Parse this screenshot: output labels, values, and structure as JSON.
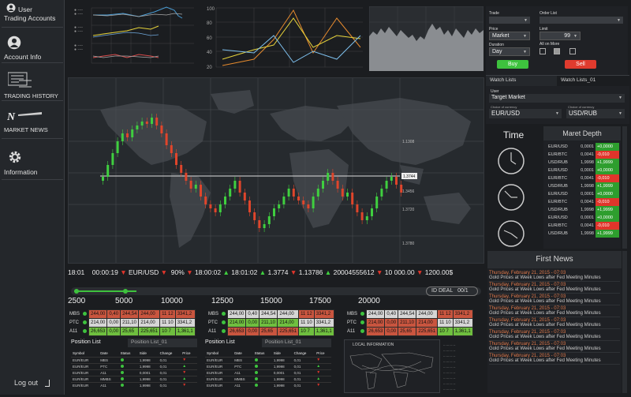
{
  "sidebar": {
    "items": [
      {
        "label_line1": "User",
        "label_line2": "Trading Accounts",
        "icon": "user-icon"
      },
      {
        "label": "Account Info",
        "icon": "user-icon"
      },
      {
        "label": "TRADING HISTORY",
        "icon": "history-icon"
      },
      {
        "label": "MARKET NEWS",
        "icon": "news-icon"
      },
      {
        "label": "Information",
        "icon": "gear-icon"
      }
    ],
    "logout": "Log out"
  },
  "map_chart": {
    "price_tags": [
      "1.1308",
      "1.3744",
      "1.3456",
      "1.3720",
      "1.3780"
    ]
  },
  "ticker": {
    "time": "18:01",
    "timer": "00:00:19",
    "pair": "EUR/USD",
    "pct": "90%",
    "t2": "18:00:02",
    "t3": "18:01:02",
    "v1": "1.3774",
    "v2": "1.13786",
    "v3": "20004555612",
    "v4": "10 000.00",
    "v5": "1200.00$"
  },
  "slider": {
    "id_deal_label": "ID DEAL",
    "id_deal_value": "00/1",
    "values": [
      "2500",
      "5000",
      "10000",
      "12500",
      "15000",
      "17500",
      "20000"
    ],
    "fill_fraction": 0.18
  },
  "quotes": {
    "rows": [
      {
        "name": "MBS",
        "cells": [
          "244,00",
          "0,40",
          "244,54",
          "244,00",
          "11 12",
          "3341,2"
        ]
      },
      {
        "name": "PTC",
        "cells": [
          "214,00",
          "0,00",
          "211,10",
          "214,00",
          "11 10",
          "3341,2"
        ]
      },
      {
        "name": "A11",
        "cells": [
          "26,653",
          "0,00",
          "25,65",
          "225,651",
          "10 7",
          "1,361,1"
        ]
      }
    ]
  },
  "position": [
    {
      "title": "Position List",
      "tab": "Position List_01"
    },
    {
      "title": "Position List",
      "tab": "Position List_01"
    }
  ],
  "position_table": {
    "headers": [
      "Symbol",
      "Date",
      "Status",
      "Side",
      "Change",
      "Price"
    ],
    "rows": [
      [
        "EUR/EUR",
        "MBS",
        "",
        "1,9998",
        "0,01",
        ""
      ],
      [
        "EUR/EUR",
        "PTC",
        "",
        "1,9998",
        "0,01",
        ""
      ],
      [
        "EUR/EUR",
        "A11",
        "",
        "0,0001",
        "0,01",
        ""
      ],
      [
        "EUR/EUR",
        "MMBS",
        "",
        "1,9998",
        "0,01",
        ""
      ],
      [
        "EUR/EUR",
        "A11",
        "",
        "1,9998",
        "0,01",
        ""
      ]
    ]
  },
  "local_info": {
    "title": "LOCAL INFORMATION"
  },
  "trade_panel": {
    "trade_label": "Trade",
    "order_list_label": "Order List",
    "price_label": "Price",
    "price_value": "Market",
    "limit_label": "Limit",
    "limit_value": "99",
    "duration_label": "Duration",
    "duration_value": "Day",
    "all_or_more_label": "All on More",
    "buy": "Buy",
    "sell": "Sell"
  },
  "watch": {
    "tab1": "Watch Lists",
    "tab2": "Watch Lists_01",
    "user_label": "User",
    "target": "Target Market",
    "choice1_label": "Choice of currency",
    "choice1": "EUR/USD",
    "choice2_label": "Choice of currency",
    "choice2": "USD/RUB"
  },
  "time_label": "Time",
  "depth": {
    "title": "Maret Depth",
    "rows": [
      [
        "EUR/USD",
        "0,0001",
        "+0,0000"
      ],
      [
        "EUR/BTC",
        "0,0041",
        "-0,010"
      ],
      [
        "USD/RUB",
        "1,9998",
        "+1,9999"
      ],
      [
        "EUR/USD",
        "0,0001",
        "+0,0000"
      ],
      [
        "EUR/BTC",
        "0,0041",
        "-0,010"
      ],
      [
        "USD/RUB",
        "1,9998",
        "+1,9999"
      ],
      [
        "EUR/USD",
        "0,0001",
        "+0,0000"
      ],
      [
        "EUR/BTC",
        "0,0041",
        "-0,010"
      ],
      [
        "USD/RUB",
        "1,9998",
        "+1,9999"
      ],
      [
        "EUR/USD",
        "0,0001",
        "+0,0000"
      ],
      [
        "EUR/BTC",
        "0,0041",
        "-0,010"
      ],
      [
        "USD/RUB",
        "1,9998",
        "+1,9999"
      ]
    ]
  },
  "news": {
    "title": "First News",
    "items": [
      {
        "date": "Thursday, February 21, 2015 - 07:03",
        "title": "Gold Prices at  Week Lows after Fed Meeting Minutes"
      },
      {
        "date": "Thursday, February 21, 2015 - 07:03",
        "title": "Gold Prices at  Week Lows after Fed Meeting Minutes"
      },
      {
        "date": "Thursday, February 21, 2015 - 07:03",
        "title": "Gold Prices at  Week Lows after Fed Meeting Minutes"
      },
      {
        "date": "Thursday, February 21, 2015 - 07:03",
        "title": "Gold Prices at  Week Lows after Fed Meeting Minutes"
      },
      {
        "date": "Thursday, February 21, 2015 - 07:03",
        "title": "Gold Prices at  Week Lows after Fed Meeting Minutes"
      },
      {
        "date": "Thursday, February 21, 2015 - 07:03",
        "title": "Gold Prices at  Week Lows after Fed Meeting Minutes"
      },
      {
        "date": "Thursday, February 21, 2015 - 07:03",
        "title": "Gold Prices at  Week Lows after Fed Meeting Minutes"
      },
      {
        "date": "Thursday, February 21, 2015 - 07:03",
        "title": "Gold Prices at  Week Lows after Fed Meeting Minutes"
      }
    ]
  },
  "colors": {
    "up": "#3fcf3f",
    "down": "#e0352b",
    "cell_red": "#c9553f",
    "cell_green": "#6fbf3f",
    "cell_gray": "#d6d6d6"
  }
}
